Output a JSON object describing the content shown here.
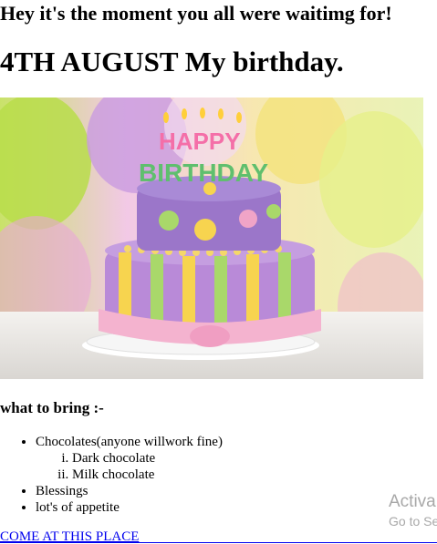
{
  "intro_heading": "Hey it's the moment you all were waitimg for!",
  "date_heading": "4TH AUGUST My birthday.",
  "image": {
    "cake_lettering": [
      "HAPPY",
      "BIRTHDAY"
    ]
  },
  "bring_heading": "what to bring :-",
  "list": {
    "items": [
      {
        "label": "Chocolates(anyone willwork fine)",
        "sub": [
          "Dark chocolate",
          "Milk chocolate"
        ]
      },
      {
        "label": "Blessings"
      },
      {
        "label": "lot's of appetite"
      }
    ]
  },
  "link_text": "COME AT THIS PLACE",
  "watermark": {
    "line1": "Activa",
    "line2": "Go to Se"
  },
  "colors": {
    "link": "#0000ee",
    "watermark": "#a8a8a8"
  }
}
